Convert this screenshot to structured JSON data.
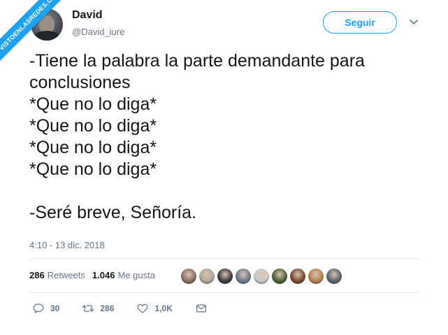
{
  "watermark": "VISTOENLASREDES.COM",
  "author": {
    "name": "David",
    "handle": "@David_iure"
  },
  "follow_button": "Seguir",
  "tweet": {
    "lines": [
      "-Tiene la palabra la parte demandante para",
      "conclusiones",
      "*Que no lo diga*",
      "*Que no lo diga*",
      "*Que no lo diga*",
      "*Que no lo diga*",
      "",
      "-Seré breve, Señoría."
    ],
    "timestamp": "4:10 - 13 dic. 2018"
  },
  "stats": {
    "retweets_count": "286",
    "retweets_label": "Retweets",
    "likes_count": "1.046",
    "likes_label": "Me gusta"
  },
  "likers": [
    {
      "color": "#8d6e63"
    },
    {
      "color": "#b0a89a"
    },
    {
      "color": "#3b3b3b"
    },
    {
      "color": "#6d7b8a"
    },
    {
      "color": "#c9c9c9"
    },
    {
      "color": "#4e5d3a"
    },
    {
      "color": "#7a4a2a"
    },
    {
      "color": "#b5834e"
    },
    {
      "color": "#5b6470"
    }
  ],
  "actions": {
    "reply_count": "30",
    "retweet_count": "286",
    "like_count": "1,0K"
  },
  "icons": {
    "reply": "reply-icon",
    "retweet": "retweet-icon",
    "like": "heart-icon",
    "message": "envelope-icon",
    "caret": "chevron-down-icon"
  },
  "colors": {
    "accent": "#1da1f2",
    "text": "#14171a",
    "muted": "#657786"
  }
}
